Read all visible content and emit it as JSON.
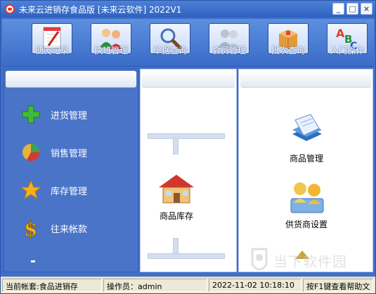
{
  "window": {
    "title": "未来云进销存食品版 [未来云软件] 2022V1",
    "btn_min": "_",
    "btn_max": "□",
    "btn_close": "×"
  },
  "toolbar": [
    {
      "label": "便笺记录",
      "icon": "notepad-icon"
    },
    {
      "label": "换班管理",
      "icon": "users-swap-icon"
    },
    {
      "label": "单据查询",
      "icon": "magnifier-icon"
    },
    {
      "label": "会员管理",
      "icon": "members-icon"
    },
    {
      "label": "批次查询",
      "icon": "box-icon"
    },
    {
      "label": "入门操作",
      "icon": "abc-icon"
    }
  ],
  "nav": [
    {
      "label": "进货管理",
      "icon": "plus-icon"
    },
    {
      "label": "销售管理",
      "icon": "pie-icon"
    },
    {
      "label": "库存管理",
      "icon": "star-icon"
    },
    {
      "label": "往来帐款",
      "icon": "dollar-icon"
    }
  ],
  "middle": {
    "label": "商品库存",
    "icon": "house-icon"
  },
  "right": [
    {
      "label": "商品管理",
      "icon": "stack-icon"
    },
    {
      "label": "供货商设置",
      "icon": "supplier-icon"
    }
  ],
  "status": {
    "account": "当前帐套:食品进销存",
    "operator": "操作员：admin",
    "datetime": "2022-11-02 10:18:10",
    "hint": "按F1键查看帮助文"
  },
  "watermark": "当下软件园",
  "colors": {
    "accent": "#3f6fc9",
    "toolbar": "#5d8fe0",
    "panel": "#4a74c8"
  }
}
